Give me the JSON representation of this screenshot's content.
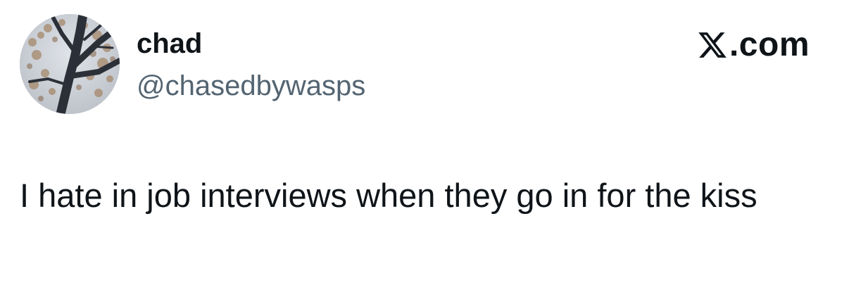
{
  "author": {
    "display_name": "chad",
    "handle": "@chasedbywasps",
    "avatar_icon": "tree-branches-avatar"
  },
  "brand": {
    "icon": "x-logo-icon",
    "label": ".com"
  },
  "tweet": {
    "text": "I hate in job interviews when they go in for the kiss"
  },
  "colors": {
    "text_primary": "#0f1419",
    "text_secondary": "#536471",
    "background": "#ffffff"
  }
}
